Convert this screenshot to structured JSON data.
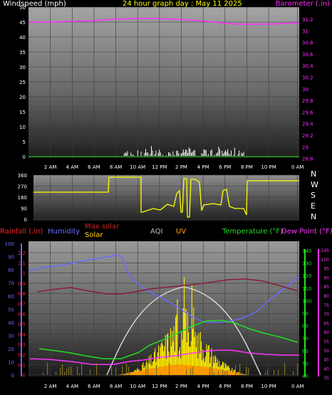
{
  "colors": {
    "wind": "#ffffff",
    "barometer": "#ff2cff",
    "direction": "#ffff00",
    "rain": "#ff2222",
    "humidity": "#6a6aff",
    "maxsolar": "#cc2222",
    "solar": "#ffd700",
    "aqi": "#bbbbbb",
    "uv": "#ffa500",
    "temperature": "#22dd22",
    "dewpoint": "#ff33ff",
    "heatindex": "#8b1a3a"
  },
  "top": {
    "left_label": "Windspeed (mph)",
    "title": "24 hour graph day : May 11 2025",
    "right_label": "Barometer (.in)",
    "wind_ticks": [
      "50",
      "45",
      "40",
      "35",
      "30",
      "25",
      "20",
      "15",
      "10",
      "5",
      "0"
    ],
    "baro_ticks": [
      "31.2",
      "31",
      "30.8",
      "30.6",
      "30.4",
      "30.2",
      "30",
      "29.8",
      "29.6",
      "29.4",
      "29.2",
      "29",
      "28.8"
    ],
    "time_ticks": [
      "2 AM",
      "4 AM",
      "6 AM",
      "8 AM",
      "10 AM",
      "12 PM",
      "2 PM",
      "4 PM",
      "6 PM",
      "8 PM",
      "10 PM",
      "0 AM"
    ]
  },
  "middle": {
    "dir_ticks": [
      "360",
      "270",
      "180",
      "90",
      "0"
    ],
    "compass": [
      "N",
      "W",
      "S",
      "E",
      "N"
    ]
  },
  "bottom": {
    "labels": {
      "rain": "Rainfall (.in)",
      "humidity": "Humidity",
      "maxsolar": "Max solar",
      "solar": "Solar",
      "aqi": "AQI",
      "uv": "UV",
      "temperature": "Temperature (°F)",
      "dewpoint": "Dew Point (°F)"
    },
    "hum_ticks": [
      "100",
      "90",
      "80",
      "70",
      "60",
      "50",
      "40",
      "30",
      "20",
      "10",
      "0"
    ],
    "rain_ticks": [
      "1.2",
      "1.1",
      "1",
      "0.9",
      "0.8",
      "0.7",
      "0.6",
      "0.5",
      "0.4",
      "0.3",
      "0.2",
      "0.1",
      "0"
    ],
    "temp_ticks": [
      "140",
      "130",
      "120",
      "110",
      "100",
      "90",
      "80",
      "70",
      "60",
      "50",
      "40"
    ],
    "dp_ticks": [
      "105",
      "100",
      "95",
      "90",
      "85",
      "80",
      "75",
      "70",
      "65",
      "60",
      "55",
      "50",
      "45",
      "40",
      "35"
    ],
    "time_ticks": [
      "2 AM",
      "4 AM",
      "6 AM",
      "8 AM",
      "10 AM",
      "12 PM",
      "2 PM",
      "4 PM",
      "6 PM",
      "8 PM",
      "10 PM",
      "0 AM"
    ]
  }
}
